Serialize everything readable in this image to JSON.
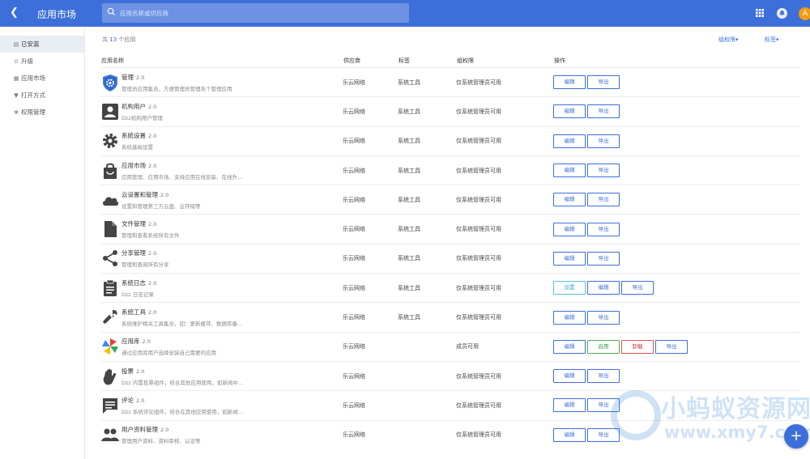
{
  "header": {
    "back_icon": "chevron-left-icon",
    "title": "应用市场",
    "search_placeholder": "应用名称或供应商",
    "avatar_letter": "A"
  },
  "sidebar": {
    "items": [
      {
        "label": "已安装",
        "icon": "file-icon",
        "glyph": "▤"
      },
      {
        "label": "升级",
        "icon": "upgrade-icon",
        "glyph": "⊙"
      },
      {
        "label": "应用市场",
        "icon": "grid-icon",
        "glyph": "▦"
      },
      {
        "label": "打开方式",
        "icon": "filter-icon",
        "glyph": "▼"
      },
      {
        "label": "权限管理",
        "icon": "gear-icon",
        "glyph": "✻"
      }
    ]
  },
  "toolbar": {
    "count_prefix": "共",
    "count": "13",
    "count_suffix": "个应用",
    "filter_perm": "组权限▾",
    "filter_tag": "标签▾"
  },
  "table": {
    "headers": [
      "应用名称",
      "供应商",
      "标签",
      "组权限",
      "操作"
    ],
    "rows": [
      {
        "name": "管理",
        "version": "2.0",
        "desc": "管理员应用集合，方便管理员管理各个管理应用",
        "vendor": "乐云网络",
        "tag": "系统工具",
        "perm": "仅系统管理员可用",
        "icon": "shield-gear-icon",
        "actions": [
          "编辑",
          "导出"
        ]
      },
      {
        "name": "机构用户",
        "version": "2.0",
        "desc": "Dzz机构用户管理",
        "vendor": "乐云网络",
        "tag": "系统工具",
        "perm": "仅系统管理员可用",
        "icon": "user-card-icon",
        "actions": [
          "编辑",
          "导出"
        ]
      },
      {
        "name": "系统设置",
        "version": "2.0",
        "desc": "系统基础设置",
        "vendor": "乐云网络",
        "tag": "系统工具",
        "perm": "仅系统管理员可用",
        "icon": "gear-icon",
        "actions": [
          "编辑",
          "导出"
        ]
      },
      {
        "name": "应用市场",
        "version": "2.0",
        "desc": "应用管理、应用市场、支持应用在线安装、在线升...",
        "vendor": "乐云网络",
        "tag": "系统工具",
        "perm": "仅系统管理员可用",
        "icon": "shopping-bag-icon",
        "actions": [
          "编辑",
          "导出"
        ]
      },
      {
        "name": "云设置和管理",
        "version": "2.0",
        "desc": "设置和管理第三方云盘、云存储等",
        "vendor": "乐云网络",
        "tag": "系统工具",
        "perm": "仅系统管理员可用",
        "icon": "cloud-icon",
        "actions": [
          "编辑",
          "导出"
        ]
      },
      {
        "name": "文件管理",
        "version": "2.0",
        "desc": "管理和查看系统所有文件",
        "vendor": "乐云网络",
        "tag": "系统工具",
        "perm": "仅系统管理员可用",
        "icon": "file-icon",
        "actions": [
          "编辑",
          "导出"
        ]
      },
      {
        "name": "分享管理",
        "version": "2.0",
        "desc": "管理和查阅所有分享",
        "vendor": "乐云网络",
        "tag": "系统工具",
        "perm": "仅系统管理员可用",
        "icon": "share-icon",
        "actions": [
          "编辑",
          "导出"
        ]
      },
      {
        "name": "系统日志",
        "version": "2.0",
        "desc": "Dzz 日志记录",
        "vendor": "乐云网络",
        "tag": "系统工具",
        "perm": "仅系统管理员可用",
        "icon": "clipboard-icon",
        "actions": [
          "设置",
          "编辑",
          "导出"
        ]
      },
      {
        "name": "系统工具",
        "version": "2.0",
        "desc": "系统维护相关工具集合，如：更新缓存、数据库备...",
        "vendor": "乐云网络",
        "tag": "系统工具",
        "perm": "仅系统管理员可用",
        "icon": "wrench-icon",
        "actions": [
          "编辑",
          "导出"
        ]
      },
      {
        "name": "应用库",
        "version": "2.0",
        "desc": "通过应用库用户选择安装自己需要的应用",
        "vendor": "乐云网络",
        "tag": "",
        "perm": "成员可用",
        "icon": "pinwheel-icon",
        "actions": [
          "编辑",
          "启用",
          "卸载",
          "导出"
        ]
      },
      {
        "name": "投票",
        "version": "2.0",
        "desc": "Dzz 内置投票组件，结合其他应用使用，如新闻中...",
        "vendor": "乐云网络",
        "tag": "",
        "perm": "仅系统管理员可用",
        "icon": "hand-icon",
        "actions": [
          "编辑",
          "导出"
        ]
      },
      {
        "name": "评论",
        "version": "2.0",
        "desc": "Dzz 系统评论组件，结合在其他应用使用，如新闻...",
        "vendor": "乐云网络",
        "tag": "",
        "perm": "仅系统管理员可用",
        "icon": "comment-icon",
        "actions": [
          "编辑",
          "导出"
        ]
      },
      {
        "name": "用户资料管理",
        "version": "2.0",
        "desc": "管理用户资料、资料审核、认证等",
        "vendor": "乐云网络",
        "tag": "",
        "perm": "仅系统管理员可用",
        "icon": "users-icon",
        "actions": [
          "编辑",
          "导出"
        ]
      }
    ]
  },
  "watermark": {
    "text": "小蚂蚁资源网",
    "url": "www.xmy7.com"
  },
  "fab_label": "+"
}
